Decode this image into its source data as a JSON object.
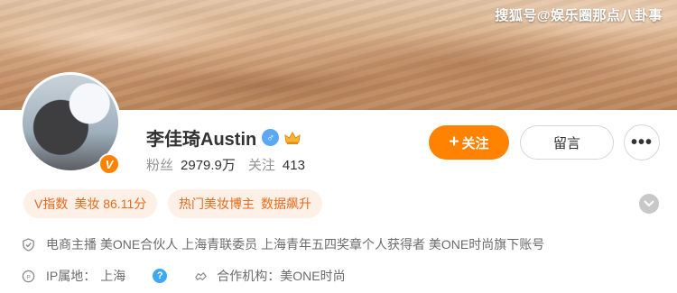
{
  "banner": {
    "watermark": "搜狐号@娱乐圈那点八卦事"
  },
  "profile": {
    "name": "李佳琦Austin",
    "fans_label": "粉丝",
    "fans_value": "2979.9万",
    "following_label": "关注",
    "following_value": "413",
    "verified_badge": "V"
  },
  "actions": {
    "follow_plus": "+",
    "follow_label": "关注",
    "message_label": "留言",
    "more_label": "•••"
  },
  "tags": [
    {
      "a": "V指数",
      "b": "美妆 86.11分"
    },
    {
      "a": "热门美妆博主",
      "b": "数据飙升"
    }
  ],
  "info": {
    "description": "电商主播 美ONE合伙人 上海青联委员 上海青年五四奖章个人获得者 美ONE时尚旗下账号",
    "ip_label": "IP属地：",
    "ip_value": "上海",
    "help": "?",
    "partner_label": "合作机构：",
    "partner_value": "美ONE时尚"
  },
  "colors": {
    "accent": "#ff8200",
    "tag_bg": "#fdf1e7",
    "tag_text": "#e86a1c",
    "male_badge": "#5aa9f2",
    "help_badge": "#3fa8f4"
  },
  "icons": {
    "verified": "verified-v-icon",
    "gender": "male-icon",
    "crown": "crown-icon",
    "shield": "shield-icon",
    "ip": "ip-location-icon",
    "partner": "handshake-icon",
    "expand": "chevron-down-icon"
  }
}
